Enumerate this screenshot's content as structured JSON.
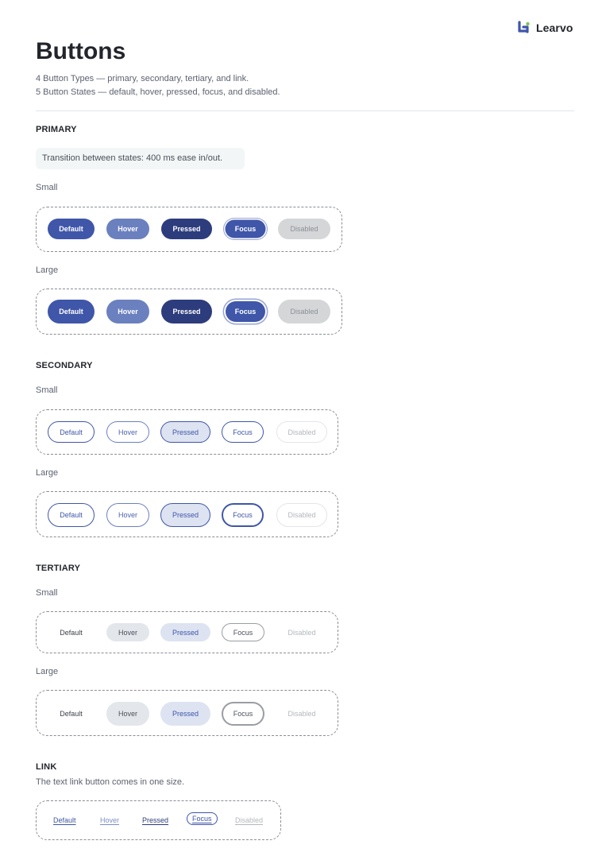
{
  "brand": {
    "name": "Learvo",
    "colors": {
      "primary": "#3f56a9",
      "accent_green": "#7fc25a"
    }
  },
  "page": {
    "title": "Buttons",
    "subtitle_line1": "4 Button Types — primary, secondary, tertiary, and link.",
    "subtitle_line2": "5 Button States —  default, hover, pressed, focus, and disabled."
  },
  "primary": {
    "heading": "PRIMARY",
    "note": "Transition between states: 400 ms ease in/out.",
    "small_label": "Small",
    "large_label": "Large"
  },
  "secondary": {
    "heading": "SECONDARY",
    "small_label": "Small",
    "large_label": "Large"
  },
  "tertiary": {
    "heading": "TERTIARY",
    "small_label": "Small",
    "large_label": "Large"
  },
  "link": {
    "heading": "LINK",
    "description": "The text link button comes in one size."
  },
  "states": [
    "Default",
    "Hover",
    "Pressed",
    "Focus",
    "Disabled"
  ]
}
